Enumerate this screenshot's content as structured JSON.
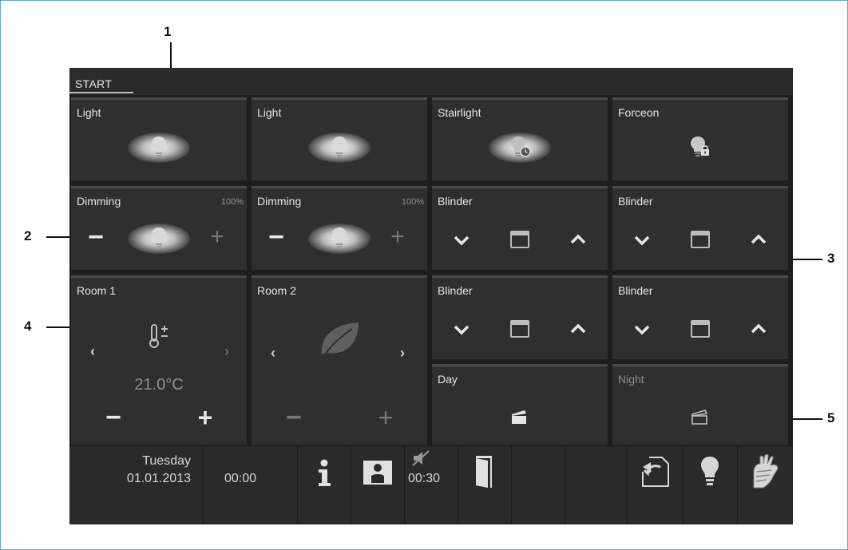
{
  "callouts": [
    "1",
    "2",
    "3",
    "4",
    "5"
  ],
  "header": {
    "title": "START"
  },
  "tiles": {
    "light1": {
      "title": "Light"
    },
    "light2": {
      "title": "Light"
    },
    "stairlight": {
      "title": "Stairlight"
    },
    "forceon": {
      "title": "Forceon"
    },
    "dimming1": {
      "title": "Dimming",
      "percent": "100%",
      "minus": "−",
      "plus": "+"
    },
    "dimming2": {
      "title": "Dimming",
      "percent": "100%",
      "minus": "−",
      "plus": "+"
    },
    "blinder1": {
      "title": "Blinder"
    },
    "blinder2": {
      "title": "Blinder"
    },
    "blinder3": {
      "title": "Blinder"
    },
    "blinder4": {
      "title": "Blinder"
    },
    "room1": {
      "title": "Room 1",
      "temperature": "21.0°C",
      "prev": "‹",
      "next": "›",
      "minus": "−",
      "plus": "+"
    },
    "room2": {
      "title": "Room 2",
      "prev": "‹",
      "next": "›",
      "minus": "−",
      "plus": "+"
    },
    "day": {
      "title": "Day"
    },
    "night": {
      "title": "Night"
    }
  },
  "status_bar": {
    "weekday": "Tuesday",
    "date": "01.01.2013",
    "time": "00:00",
    "timer": "00:30",
    "icons": [
      "info-icon",
      "person-icon",
      "mute-timer-icon",
      "door-icon",
      "back-icon",
      "bulb-icon",
      "cleaning-hand-icon"
    ]
  },
  "colors": {
    "screen_bg": "#1e1e1e",
    "tile_bg": "#2f2f2f",
    "text": "#e6e6e6",
    "frame": "#5aa9d6"
  }
}
